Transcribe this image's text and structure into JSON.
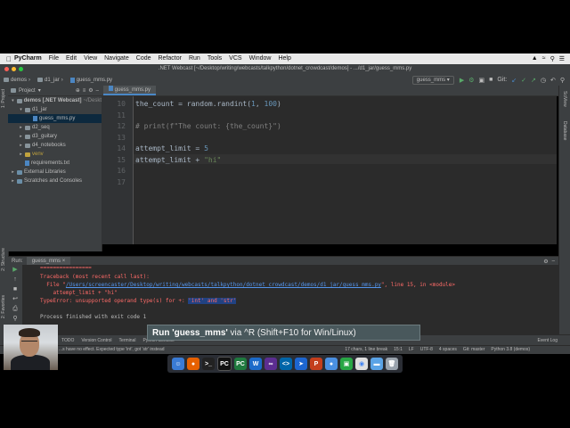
{
  "menubar": {
    "app": "PyCharm",
    "items": [
      "File",
      "Edit",
      "View",
      "Navigate",
      "Code",
      "Refactor",
      "Run",
      "Tools",
      "VCS",
      "Window",
      "Help"
    ]
  },
  "window": {
    "title": ".NET Webcast [~/Desktop/writing/webcasts/talkpython/dotnet_crowdcast/demos] - .../d1_jar/guess_mms.py"
  },
  "navbar": {
    "crumbs": [
      "demos",
      "d1_jar",
      "guess_mms.py"
    ],
    "run_config": "guess_mms",
    "git_label": "Git:"
  },
  "project_panel": {
    "title": "Project",
    "tree": [
      {
        "label": "demos [.NET Webcast]",
        "suffix": "~/Deskt",
        "indent": 0,
        "open": true,
        "type": "folder"
      },
      {
        "label": "d1_jar",
        "indent": 1,
        "open": true,
        "type": "folder"
      },
      {
        "label": "guess_mms.py",
        "indent": 2,
        "type": "file",
        "selected": true
      },
      {
        "label": "d2_seq",
        "indent": 1,
        "type": "folder"
      },
      {
        "label": "d3_guitary",
        "indent": 1,
        "type": "folder"
      },
      {
        "label": "d4_notebooks",
        "indent": 1,
        "type": "folder"
      },
      {
        "label": "venv",
        "indent": 1,
        "type": "folder"
      },
      {
        "label": "requirements.txt",
        "indent": 1,
        "type": "file"
      },
      {
        "label": "External Libraries",
        "indent": 0,
        "type": "lib"
      },
      {
        "label": "Scratches and Consoles",
        "indent": 0,
        "type": "lib"
      }
    ]
  },
  "editor": {
    "tab": "guess_mms.py",
    "line_numbers": [
      "10",
      "11",
      "12",
      "13",
      "14",
      "15",
      "16",
      "17"
    ],
    "code": {
      "l10_a": "the_count = random.randint(",
      "l10_n1": "1",
      "l10_b": ", ",
      "l10_n2": "100",
      "l10_c": ")",
      "l12": "# print(f\"The count: {the_count}\")",
      "l14_a": "attempt_limit = ",
      "l14_n": "5",
      "l15_a": "attempt_limit + ",
      "l15_s": "\"hi\""
    }
  },
  "run_panel": {
    "label": "Run:",
    "tab": "guess_mms",
    "console": {
      "sep": "================",
      "tb": "Traceback (most recent call last):",
      "file_pre": "  File \"",
      "file_link": "/Users/screencaster/Desktop/writing/webcasts/talkpython/dotnet_crowdcast/demos/d1_jar/guess_mms.py",
      "file_post": "\", line 15, in <module>",
      "code": "    attempt_limit + \"hi\"",
      "err_pre": "TypeError: unsupported operand type(s) for +: ",
      "err_hl": "'int' and 'str'",
      "exit": "Process finished with exit code 1"
    }
  },
  "bottom_tabs": [
    "TODO",
    "Version Control",
    "Terminal",
    "Python Console"
  ],
  "event_log": "Event Log",
  "status": {
    "message": "...s have no effect. Expected type 'int', got 'str' instead",
    "chars": "17 chars, 1 line break",
    "pos": "15:1",
    "lf": "LF",
    "enc": "UTF-8",
    "indent": "4 spaces",
    "git": "Git: master",
    "python": "Python 3.8 (demos)"
  },
  "overlay": {
    "run": "Run 'guess_mms'",
    "via": " via ^R (Shift+F10 for Win/Linux)"
  },
  "side_tabs": {
    "structure": "2: Structure",
    "favorites": "2: Favorites",
    "project": "1: Project",
    "sciview": "SciView",
    "database": "Database"
  },
  "colors": {
    "editor_bg": "#2b2b2b",
    "panel_bg": "#3c3f41",
    "accent": "#4a88c7",
    "error": "#ff6b68"
  }
}
